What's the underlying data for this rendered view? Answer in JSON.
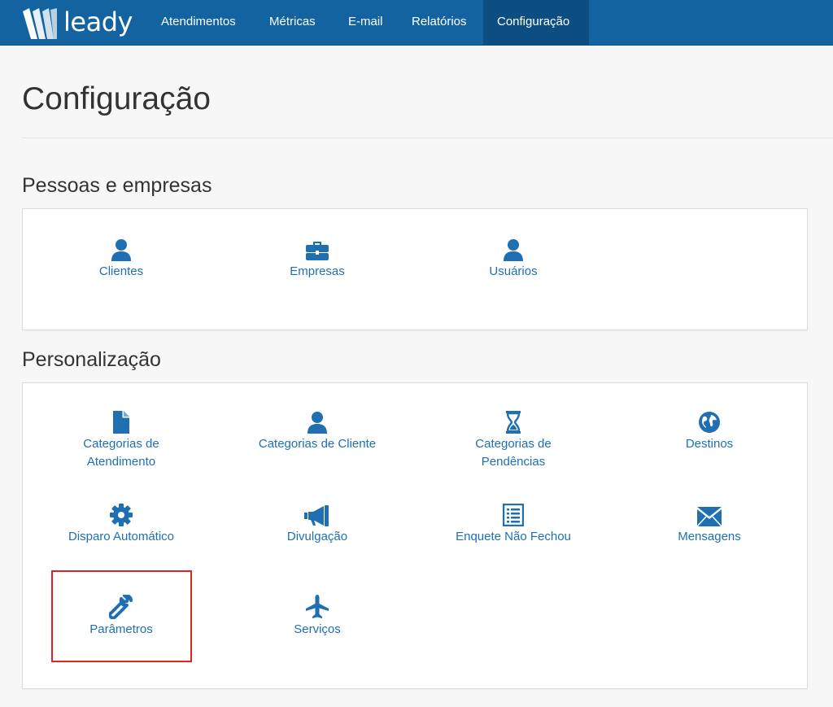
{
  "brand": {
    "name": "leady"
  },
  "nav": {
    "items": [
      "Atendimentos",
      "Métricas",
      "E-mail",
      "Relatórios",
      "Configuração"
    ],
    "active": "Configuração"
  },
  "page": {
    "title": "Configuração"
  },
  "sections": [
    {
      "title": "Pessoas e empresas",
      "items": [
        {
          "label": "Clientes",
          "icon": "user-icon"
        },
        {
          "label": "Empresas",
          "icon": "briefcase-icon"
        },
        {
          "label": "Usuários",
          "icon": "user-icon"
        }
      ]
    },
    {
      "title": "Personalização",
      "items": [
        {
          "label": "Categorias de Atendimento",
          "icon": "file-icon"
        },
        {
          "label": "Categorias de Cliente",
          "icon": "user-icon"
        },
        {
          "label": "Categorias de Pendências",
          "icon": "hourglass-icon"
        },
        {
          "label": "Destinos",
          "icon": "globe-icon"
        },
        {
          "label": "Disparo Automático",
          "icon": "gear-icon"
        },
        {
          "label": "Divulgação",
          "icon": "megaphone-icon"
        },
        {
          "label": "Enquete Não Fechou",
          "icon": "list-icon"
        },
        {
          "label": "Mensagens",
          "icon": "envelope-icon"
        },
        {
          "label": "Parâmetros",
          "icon": "wrench-icon"
        },
        {
          "label": "Serviços",
          "icon": "plane-icon"
        }
      ]
    }
  ],
  "colors": {
    "navbar": "#1463a1",
    "nav_active": "#0d4e82",
    "link": "#1f6fb2",
    "highlight": "#e02424"
  }
}
